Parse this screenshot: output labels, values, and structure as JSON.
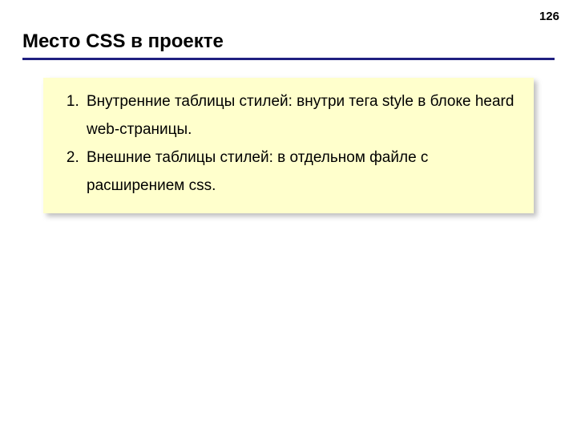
{
  "page_number": "126",
  "title": "Место CSS в проекте",
  "list": {
    "item1": "Внутренние таблицы стилей: внутри тега style  в блоке heard web-страницы.",
    "item2": "Внешние таблицы стилей: в отдельном файле с расширением css."
  }
}
